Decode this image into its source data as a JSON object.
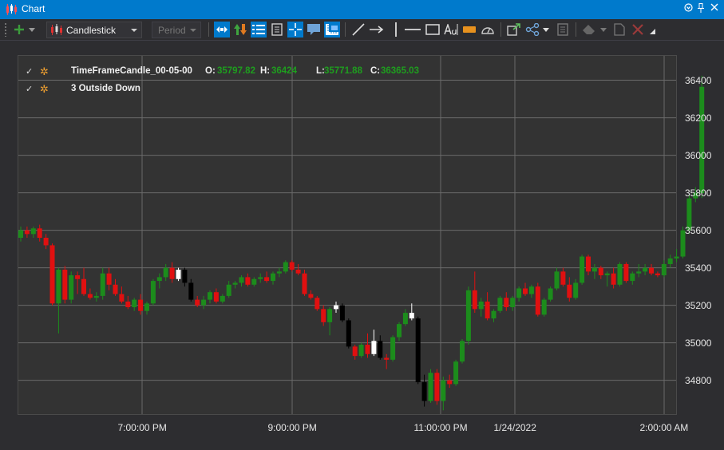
{
  "window": {
    "title": "Chart",
    "pin_glyph": "⚲",
    "close_glyph": "✕",
    "menu_glyph": "▾"
  },
  "toolbar": {
    "chart_type": "Candlestick",
    "period_placeholder": "Period",
    "icons": [
      "add-icon",
      "candlestick-icon",
      "chart-type-dropdown",
      "period-dropdown",
      "scroll-axis-icon",
      "buy-sell-icon",
      "legend-list-icon",
      "document-icon",
      "crosshair-icon",
      "comment-icon",
      "ruler-icon",
      "line-icon",
      "arrow-icon",
      "horizontal-line-icon",
      "rectangle-icon",
      "text-icon",
      "highlight-icon",
      "gauge-icon",
      "export-icon",
      "share-icon",
      "notes-icon",
      "eraser-icon",
      "new-document-icon",
      "delete-icon"
    ]
  },
  "legend": {
    "series": [
      {
        "name": "TimeFrameCandle_00-05-00",
        "checked": true,
        "o_label": "O:",
        "o": "35797.82",
        "h_label": "H:",
        "h": "36424",
        "l_label": "L:",
        "l": "35771.88",
        "c_label": "C:",
        "c": "36365.03"
      },
      {
        "name": "3 Outside Down",
        "checked": true
      }
    ]
  },
  "colors": {
    "up": "#1c8c1c",
    "down": "#e01010",
    "pattern_up": "#ffffff",
    "pattern_down": "#000000",
    "grid": "#6a6a6a",
    "accent": "#007acc"
  },
  "chart_data": {
    "type": "candlestick",
    "y_ticks": [
      "36400",
      "36200",
      "36000",
      "35800",
      "35600",
      "35400",
      "35200",
      "35000",
      "34800"
    ],
    "y_tick_values": [
      36400,
      36200,
      36000,
      35800,
      35600,
      35400,
      35200,
      35000,
      34800
    ],
    "x_ticks": [
      "7:00:00 PM",
      "9:00:00 PM",
      "11:00:00 PM",
      "1/24/2022",
      "2:00:00 AM"
    ],
    "ylim": [
      34620,
      36530
    ],
    "bars_per_hour": 12,
    "candles": [
      [
        35560,
        35620,
        35540,
        35600,
        "n"
      ],
      [
        35600,
        35620,
        35560,
        35580,
        "n"
      ],
      [
        35580,
        35620,
        35560,
        35610,
        "n"
      ],
      [
        35610,
        35630,
        35540,
        35560,
        "n"
      ],
      [
        35560,
        35580,
        35500,
        35520,
        "n"
      ],
      [
        35520,
        35530,
        35200,
        35210,
        "n"
      ],
      [
        35210,
        35400,
        35050,
        35390,
        "n"
      ],
      [
        35390,
        35410,
        35210,
        35230,
        "n"
      ],
      [
        35230,
        35380,
        35210,
        35360,
        "n"
      ],
      [
        35360,
        35380,
        35260,
        35340,
        "n"
      ],
      [
        35340,
        35400,
        35250,
        35260,
        "n"
      ],
      [
        35260,
        35290,
        35230,
        35240,
        "n"
      ],
      [
        35240,
        35270,
        35220,
        35250,
        "n"
      ],
      [
        35250,
        35400,
        35230,
        35370,
        "n"
      ],
      [
        35370,
        35400,
        35280,
        35310,
        "n"
      ],
      [
        35310,
        35340,
        35250,
        35260,
        "n"
      ],
      [
        35260,
        35300,
        35210,
        35220,
        "n"
      ],
      [
        35220,
        35250,
        35180,
        35190,
        "n"
      ],
      [
        35190,
        35240,
        35170,
        35230,
        "n"
      ],
      [
        35230,
        35260,
        35150,
        35170,
        "n"
      ],
      [
        35170,
        35220,
        35150,
        35210,
        "n"
      ],
      [
        35210,
        35340,
        35200,
        35330,
        "n"
      ],
      [
        35330,
        35370,
        35290,
        35350,
        "n"
      ],
      [
        35350,
        35420,
        35330,
        35400,
        "n"
      ],
      [
        35400,
        35430,
        35320,
        35340,
        "n"
      ],
      [
        35340,
        35400,
        35330,
        35390,
        "pu"
      ],
      [
        35390,
        35400,
        35300,
        35320,
        "pd"
      ],
      [
        35320,
        35340,
        35220,
        35230,
        "pd"
      ],
      [
        35230,
        35250,
        35190,
        35200,
        "n"
      ],
      [
        35200,
        35250,
        35180,
        35230,
        "n"
      ],
      [
        35230,
        35280,
        35210,
        35270,
        "n"
      ],
      [
        35270,
        35290,
        35210,
        35220,
        "n"
      ],
      [
        35220,
        35260,
        35210,
        35250,
        "n"
      ],
      [
        35250,
        35330,
        35240,
        35310,
        "n"
      ],
      [
        35310,
        35330,
        35290,
        35320,
        "n"
      ],
      [
        35320,
        35360,
        35300,
        35350,
        "n"
      ],
      [
        35350,
        35370,
        35300,
        35310,
        "n"
      ],
      [
        35310,
        35350,
        35300,
        35340,
        "n"
      ],
      [
        35340,
        35370,
        35320,
        35350,
        "n"
      ],
      [
        35350,
        35380,
        35320,
        35330,
        "n"
      ],
      [
        35330,
        35380,
        35310,
        35370,
        "n"
      ],
      [
        35370,
        35400,
        35350,
        35380,
        "n"
      ],
      [
        35380,
        35440,
        35370,
        35430,
        "n"
      ],
      [
        35430,
        35440,
        35380,
        35390,
        "n"
      ],
      [
        35390,
        35420,
        35360,
        35370,
        "n"
      ],
      [
        35370,
        35390,
        35250,
        35260,
        "n"
      ],
      [
        35260,
        35280,
        35230,
        35240,
        "n"
      ],
      [
        35240,
        35250,
        35170,
        35180,
        "n"
      ],
      [
        35180,
        35200,
        35090,
        35110,
        "n"
      ],
      [
        35110,
        35190,
        35040,
        35180,
        "n"
      ],
      [
        35180,
        35220,
        35160,
        35200,
        "pu"
      ],
      [
        35200,
        35210,
        35110,
        35120,
        "pd"
      ],
      [
        35120,
        35130,
        34970,
        34980,
        "pd"
      ],
      [
        34980,
        34990,
        34910,
        34930,
        "n"
      ],
      [
        34930,
        35000,
        34920,
        34990,
        "n"
      ],
      [
        34990,
        35050,
        34920,
        34940,
        "n"
      ],
      [
        34940,
        35070,
        34930,
        35010,
        "pu"
      ],
      [
        35010,
        35040,
        34910,
        34920,
        "pd"
      ],
      [
        34920,
        34940,
        34860,
        34910,
        "n"
      ],
      [
        34910,
        35040,
        34900,
        35030,
        "n"
      ],
      [
        35030,
        35110,
        35010,
        35100,
        "n"
      ],
      [
        35100,
        35180,
        35090,
        35160,
        "n"
      ],
      [
        35160,
        35210,
        35120,
        35130,
        "pu"
      ],
      [
        35130,
        35140,
        34780,
        34790,
        "pd"
      ],
      [
        34790,
        34830,
        34660,
        34690,
        "pd"
      ],
      [
        34690,
        34860,
        34680,
        34840,
        "n"
      ],
      [
        34840,
        34860,
        34670,
        34690,
        "n"
      ],
      [
        34690,
        34820,
        34640,
        34800,
        "n"
      ],
      [
        34800,
        34830,
        34760,
        34780,
        "n"
      ],
      [
        34780,
        34910,
        34770,
        34900,
        "n"
      ],
      [
        34900,
        35020,
        34890,
        35010,
        "n"
      ],
      [
        35010,
        35300,
        34990,
        35280,
        "n"
      ],
      [
        35280,
        35380,
        35160,
        35180,
        "n"
      ],
      [
        35180,
        35240,
        35140,
        35220,
        "n"
      ],
      [
        35220,
        35270,
        35120,
        35130,
        "n"
      ],
      [
        35130,
        35180,
        35110,
        35170,
        "n"
      ],
      [
        35170,
        35250,
        35160,
        35240,
        "n"
      ],
      [
        35240,
        35270,
        35170,
        35190,
        "n"
      ],
      [
        35190,
        35250,
        35170,
        35240,
        "n"
      ],
      [
        35240,
        35300,
        35220,
        35290,
        "n"
      ],
      [
        35290,
        35320,
        35250,
        35260,
        "n"
      ],
      [
        35260,
        35310,
        35240,
        35300,
        "n"
      ],
      [
        35300,
        35320,
        35140,
        35150,
        "n"
      ],
      [
        35150,
        35240,
        35140,
        35230,
        "n"
      ],
      [
        35230,
        35300,
        35220,
        35290,
        "n"
      ],
      [
        35290,
        35400,
        35280,
        35380,
        "n"
      ],
      [
        35380,
        35400,
        35300,
        35310,
        "n"
      ],
      [
        35310,
        35350,
        35220,
        35240,
        "n"
      ],
      [
        35240,
        35340,
        35230,
        35320,
        "n"
      ],
      [
        35320,
        35470,
        35310,
        35460,
        "n"
      ],
      [
        35460,
        35470,
        35360,
        35380,
        "n"
      ],
      [
        35380,
        35420,
        35340,
        35400,
        "n"
      ],
      [
        35400,
        35410,
        35340,
        35360,
        "n"
      ],
      [
        35360,
        35380,
        35300,
        35370,
        "n"
      ],
      [
        35370,
        35400,
        35290,
        35310,
        "n"
      ],
      [
        35310,
        35430,
        35300,
        35420,
        "n"
      ],
      [
        35420,
        35430,
        35320,
        35330,
        "n"
      ],
      [
        35330,
        35380,
        35310,
        35370,
        "n"
      ],
      [
        35370,
        35420,
        35350,
        35380,
        "n"
      ],
      [
        35380,
        35420,
        35360,
        35400,
        "n"
      ],
      [
        35400,
        35420,
        35360,
        35370,
        "n"
      ],
      [
        35370,
        35380,
        35350,
        35360,
        "n"
      ],
      [
        35360,
        35440,
        35350,
        35420,
        "n"
      ],
      [
        35420,
        35470,
        35400,
        35450,
        "n"
      ],
      [
        35450,
        35500,
        35430,
        35460,
        "n"
      ],
      [
        35460,
        35620,
        35450,
        35600,
        "n"
      ],
      [
        35600,
        35790,
        35580,
        35770,
        "n"
      ],
      [
        35770,
        35830,
        35750,
        35800,
        "n"
      ],
      [
        35797.82,
        36424,
        35771.88,
        36365.03,
        "n"
      ]
    ]
  }
}
